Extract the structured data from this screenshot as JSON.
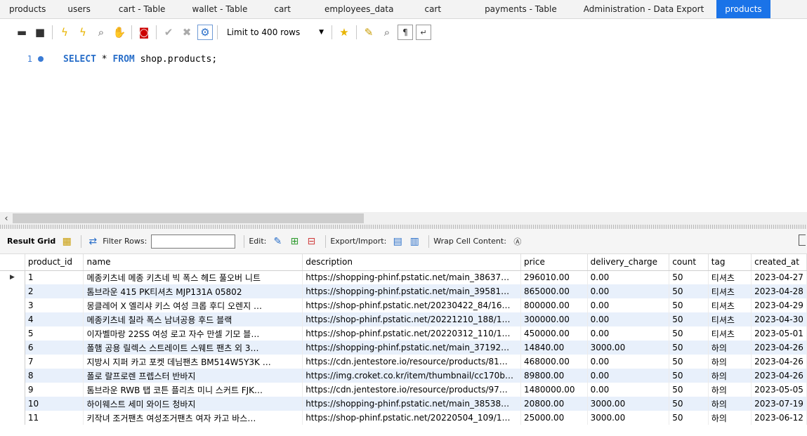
{
  "tabs": [
    {
      "label": "products"
    },
    {
      "label": "users"
    },
    {
      "label": "cart - Table"
    },
    {
      "label": "wallet - Table"
    },
    {
      "label": "cart"
    },
    {
      "label": "employees_data"
    },
    {
      "label": "cart"
    },
    {
      "label": "payments - Table"
    },
    {
      "label": "Administration - Data Export"
    },
    {
      "label": "products"
    }
  ],
  "toolbar": {
    "limit_label": "Limit to 400 rows"
  },
  "editor": {
    "line_number": "1",
    "sql_keyword1": "SELECT",
    "sql_star": " * ",
    "sql_keyword2": "FROM",
    "sql_rest": " shop.products;"
  },
  "result_toolbar": {
    "result_grid": "Result Grid",
    "filter_rows": "Filter Rows:",
    "edit": "Edit:",
    "export_import": "Export/Import:",
    "wrap_cell": "Wrap Cell Content:"
  },
  "columns": [
    "product_id",
    "name",
    "description",
    "price",
    "delivery_charge",
    "count",
    "tag",
    "created_at"
  ],
  "rows": [
    [
      "1",
      "메종키츠네 메종 키츠네 빅 폭스 헤드 풀오버 니트",
      "https://shopping-phinf.pstatic.net/main_38637…",
      "296010.00",
      "0.00",
      "50",
      "티셔츠",
      "2023-04-27"
    ],
    [
      "2",
      "톰브라운 415 PK티셔츠 MJP131A 05802",
      "https://shopping-phinf.pstatic.net/main_39581…",
      "865000.00",
      "0.00",
      "50",
      "티셔츠",
      "2023-04-28"
    ],
    [
      "3",
      "몽클레어 X 엘리샤 키스 여성 크롭 후디 오렌지 …",
      "https://shop-phinf.pstatic.net/20230422_84/16…",
      "800000.00",
      "0.00",
      "50",
      "티셔츠",
      "2023-04-29"
    ],
    [
      "4",
      "메종키츠네 칠라 폭스 남녀공용 후드 블랙",
      "https://shop-phinf.pstatic.net/20221210_188/1…",
      "300000.00",
      "0.00",
      "50",
      "티셔츠",
      "2023-04-30"
    ],
    [
      "5",
      "이자벨마랑 22SS 여성 로고 자수 만셀 기모 블…",
      "https://shop-phinf.pstatic.net/20220312_110/1…",
      "450000.00",
      "0.00",
      "50",
      "티셔츠",
      "2023-05-01"
    ],
    [
      "6",
      "폴햄 공용 릴렉스 스트레이트 스웨트 팬츠 외 3…",
      "https://shopping-phinf.pstatic.net/main_37192…",
      "14840.00",
      "3000.00",
      "50",
      "하의",
      "2023-04-26"
    ],
    [
      "7",
      "지방시 지퍼 카고 포켓 데님팬츠 BM514W5Y3K …",
      "https://cdn.jentestore.io/resource/products/81…",
      "468000.00",
      "0.00",
      "50",
      "하의",
      "2023-04-26"
    ],
    [
      "8",
      "폴로 랄프로렌 프렙스터 반바지",
      "https://img.croket.co.kr/item/thumbnail/cc170b…",
      "89800.00",
      "0.00",
      "50",
      "하의",
      "2023-04-26"
    ],
    [
      "9",
      "톰브라운 RWB 탭 코튼 플리츠 미니 스커트 FJK…",
      "https://cdn.jentestore.io/resource/products/97…",
      "1480000.00",
      "0.00",
      "50",
      "하의",
      "2023-05-05"
    ],
    [
      "10",
      "하이웨스트 세미 와이드 청바지",
      "https://shopping-phinf.pstatic.net/main_38538…",
      "20800.00",
      "3000.00",
      "50",
      "하의",
      "2023-07-19"
    ],
    [
      "11",
      "키작녀 조거팬츠 여성조거팬츠 여자 카고 바스…",
      "https://shop-phinf.pstatic.net/20220504_109/1…",
      "25000.00",
      "3000.00",
      "50",
      "하의",
      "2023-06-12"
    ]
  ],
  "current_row_marker": "▶"
}
